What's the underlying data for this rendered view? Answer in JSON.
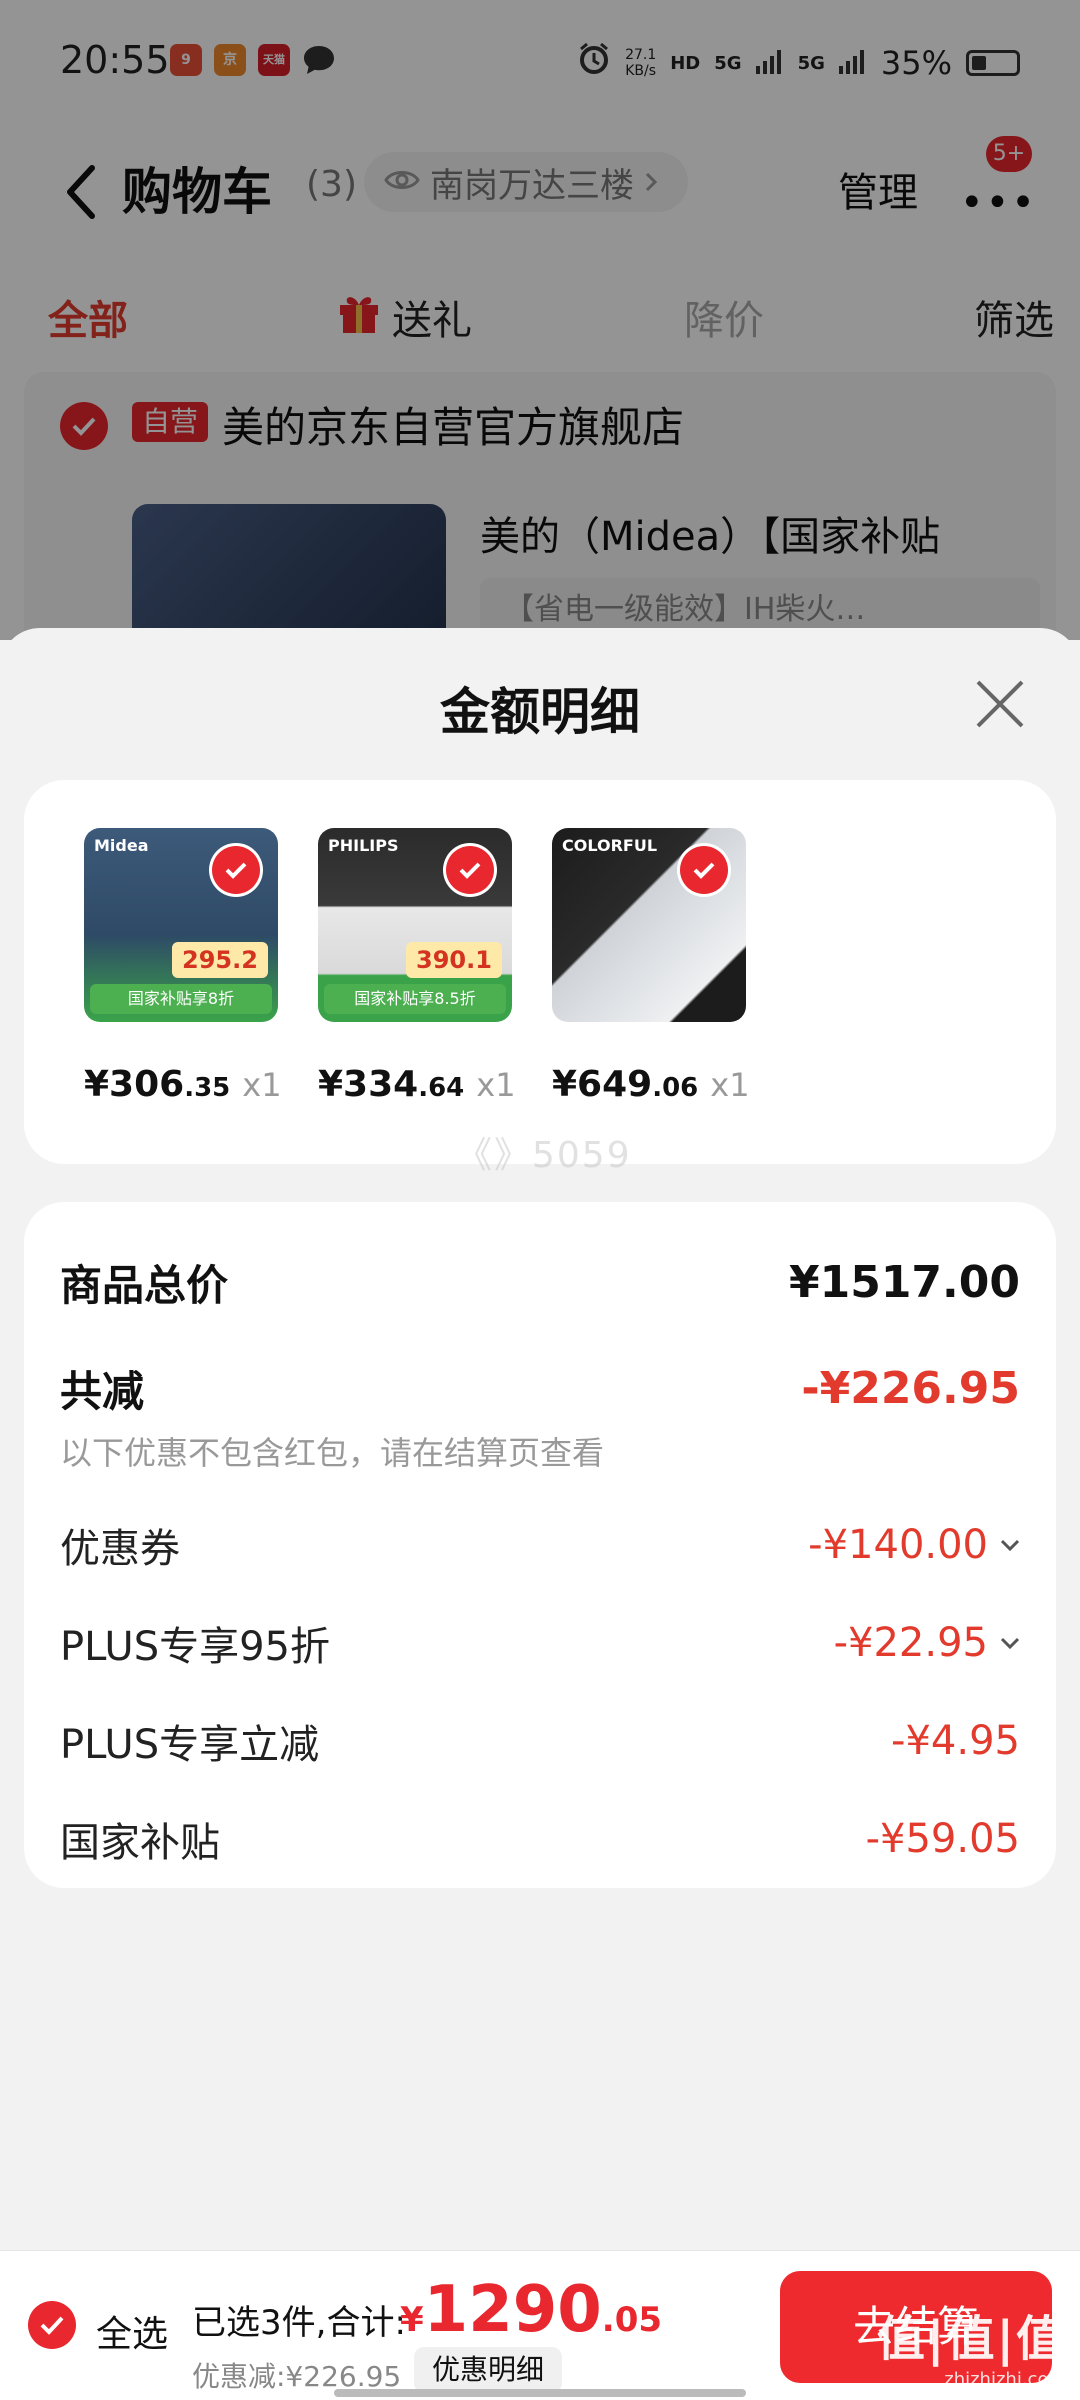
{
  "status_bar": {
    "time": "20:55",
    "app_icons": [
      {
        "name": "app-icon-1",
        "label": "9",
        "color": "#e8503a"
      },
      {
        "name": "app-icon-2",
        "label": "京",
        "color": "#f08a2c"
      },
      {
        "name": "app-icon-3",
        "label": "天猫",
        "color": "#d81e2a"
      }
    ],
    "network_speed": "27.1 KB/s",
    "network_speed_value": "27.1",
    "network_speed_unit": "KB/s",
    "hd_label": "HD",
    "net_5g_1": "5G",
    "net_5g_2": "5G",
    "battery": "35%"
  },
  "header": {
    "title": "购物车",
    "count": "(3)",
    "location": "南岗万达三楼",
    "manage_label": "管理",
    "more_badge": "5+"
  },
  "tabs": {
    "all": "全部",
    "gift": "送礼",
    "price_drop": "降价",
    "filter": "筛选"
  },
  "store": {
    "tag": "自营",
    "name": "美的京东自营官方旗舰店",
    "product_title": "美的（Midea）【国家补贴",
    "product_spec": "【省电一级能效】IH柴火…"
  },
  "sheet": {
    "title": "金额明细",
    "items": [
      {
        "brand": "Midea",
        "tag": "国家补贴享8折",
        "badge_price": "295.2",
        "price_int": "¥306",
        "price_dec": ".35",
        "qty": "x1",
        "bg": "#3d5a7a"
      },
      {
        "brand": "PHILIPS",
        "tag": "国家补贴享8.5折",
        "badge_price": "390.1",
        "price_int": "¥334",
        "price_dec": ".64",
        "qty": "x1",
        "bg": "#2b2b2b"
      },
      {
        "brand": "COLORFUL",
        "tag": "",
        "badge_price": "",
        "price_int": "¥649",
        "price_dec": ".06",
        "qty": "x1",
        "bg": "#1c1c1c"
      }
    ],
    "watermark": "《》5059",
    "summary": {
      "subtotal_label": "商品总价",
      "subtotal_value": "¥1517.00",
      "total_discount_label": "共减",
      "total_discount_value": "-¥226.95",
      "note": "以下优惠不包含红包，请在结算页查看",
      "lines": [
        {
          "label": "优惠券",
          "value": "-¥140.00",
          "expandable": true
        },
        {
          "label": "PLUS专享95折",
          "value": "-¥22.95",
          "expandable": true
        },
        {
          "label": "PLUS专享立减",
          "value": "-¥4.95",
          "expandable": false
        },
        {
          "label": "国家补贴",
          "value": "-¥59.05",
          "expandable": false
        }
      ]
    }
  },
  "action_bar": {
    "select_all": "全选",
    "selected_text": "已选3件,合计:",
    "total_currency": "¥",
    "total_int": "1290",
    "total_dec": ".05",
    "discount_text": "优惠减:¥226.95",
    "detail_button": "优惠明细",
    "checkout_button": "去结算"
  },
  "watermark_corner": {
    "big": "值|值|值",
    "small": "zhizhizhi.com"
  },
  "colors": {
    "accent": "#e8272e",
    "discount_text": "#e23b2d"
  }
}
